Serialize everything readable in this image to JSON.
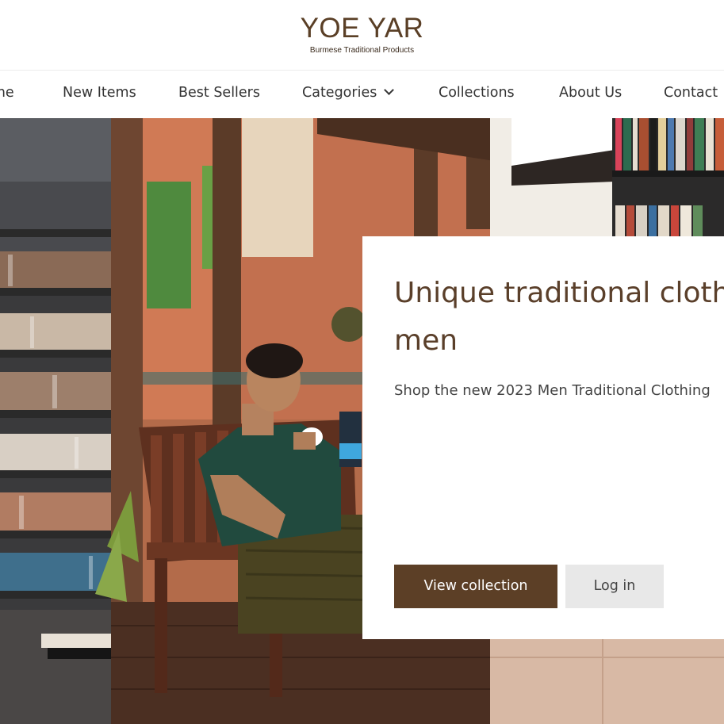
{
  "brand": {
    "title": "YOE YAR",
    "subtitle": "Burmese Traditional Products"
  },
  "nav": {
    "items": [
      {
        "label": "Home"
      },
      {
        "label": "New Items"
      },
      {
        "label": "Best Sellers"
      },
      {
        "label": "Categories"
      },
      {
        "label": "Collections"
      },
      {
        "label": "About Us"
      },
      {
        "label": "Contact"
      }
    ]
  },
  "hero": {
    "title": "Unique traditional cloth men",
    "subtitle": "Shop the new 2023 Men Traditional Clothing",
    "primary_button": "View collection",
    "secondary_button": "Log in"
  },
  "colors": {
    "brand": "#5a3f26",
    "primary_button": "#5c3f26",
    "secondary_button": "#e8e8e8"
  }
}
